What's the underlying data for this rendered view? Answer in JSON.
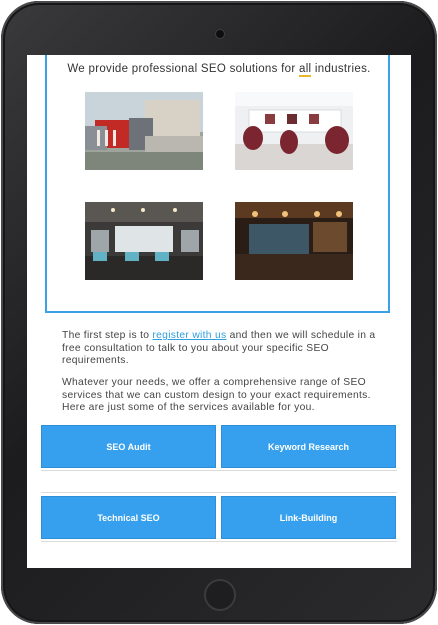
{
  "intro": {
    "before": "We provide professional SEO solutions for ",
    "highlight": "all",
    "after": " industries."
  },
  "images": [
    {
      "name": "factory-image"
    },
    {
      "name": "salon-image"
    },
    {
      "name": "office-image"
    },
    {
      "name": "restaurant-image"
    }
  ],
  "paragraph1": {
    "before": "The first step is to ",
    "link": "register with us",
    "after": " and then we will schedule in a free consultation to talk to you about your specific SEO requirements."
  },
  "paragraph2": "Whatever your needs, we offer a comprehensive range of SEO services that we can custom design to your exact requirements. Here are just some of the services available for you.",
  "services": [
    "SEO Audit",
    "Keyword Research",
    "Technical SEO",
    "Link-Building"
  ],
  "colors": {
    "accent": "#37a0ee",
    "border": "#3aa0e8",
    "link": "#2e9ee0",
    "highlight_underline": "#e8b828",
    "tablet": "#2b2b2d"
  }
}
